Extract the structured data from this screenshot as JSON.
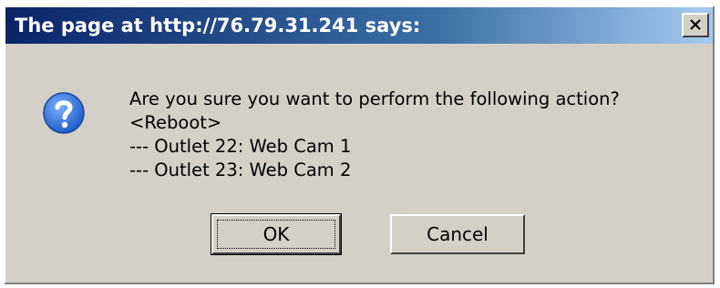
{
  "dialog": {
    "title": "The page at http://76.79.31.241 says:",
    "close_symbol": "×",
    "icon": "question-icon",
    "message_lines": [
      "Are you sure you want to perform the following action?",
      "<Reboot>",
      "--- Outlet 22: Web Cam 1",
      "--- Outlet 23: Web Cam 2"
    ],
    "ok_label": "OK",
    "cancel_label": "Cancel"
  },
  "colors": {
    "titlebar_start": "#0a246a",
    "titlebar_end": "#a6caf0",
    "dialog_bg": "#d4d0c8",
    "icon_blue": "#2f6fd6"
  }
}
